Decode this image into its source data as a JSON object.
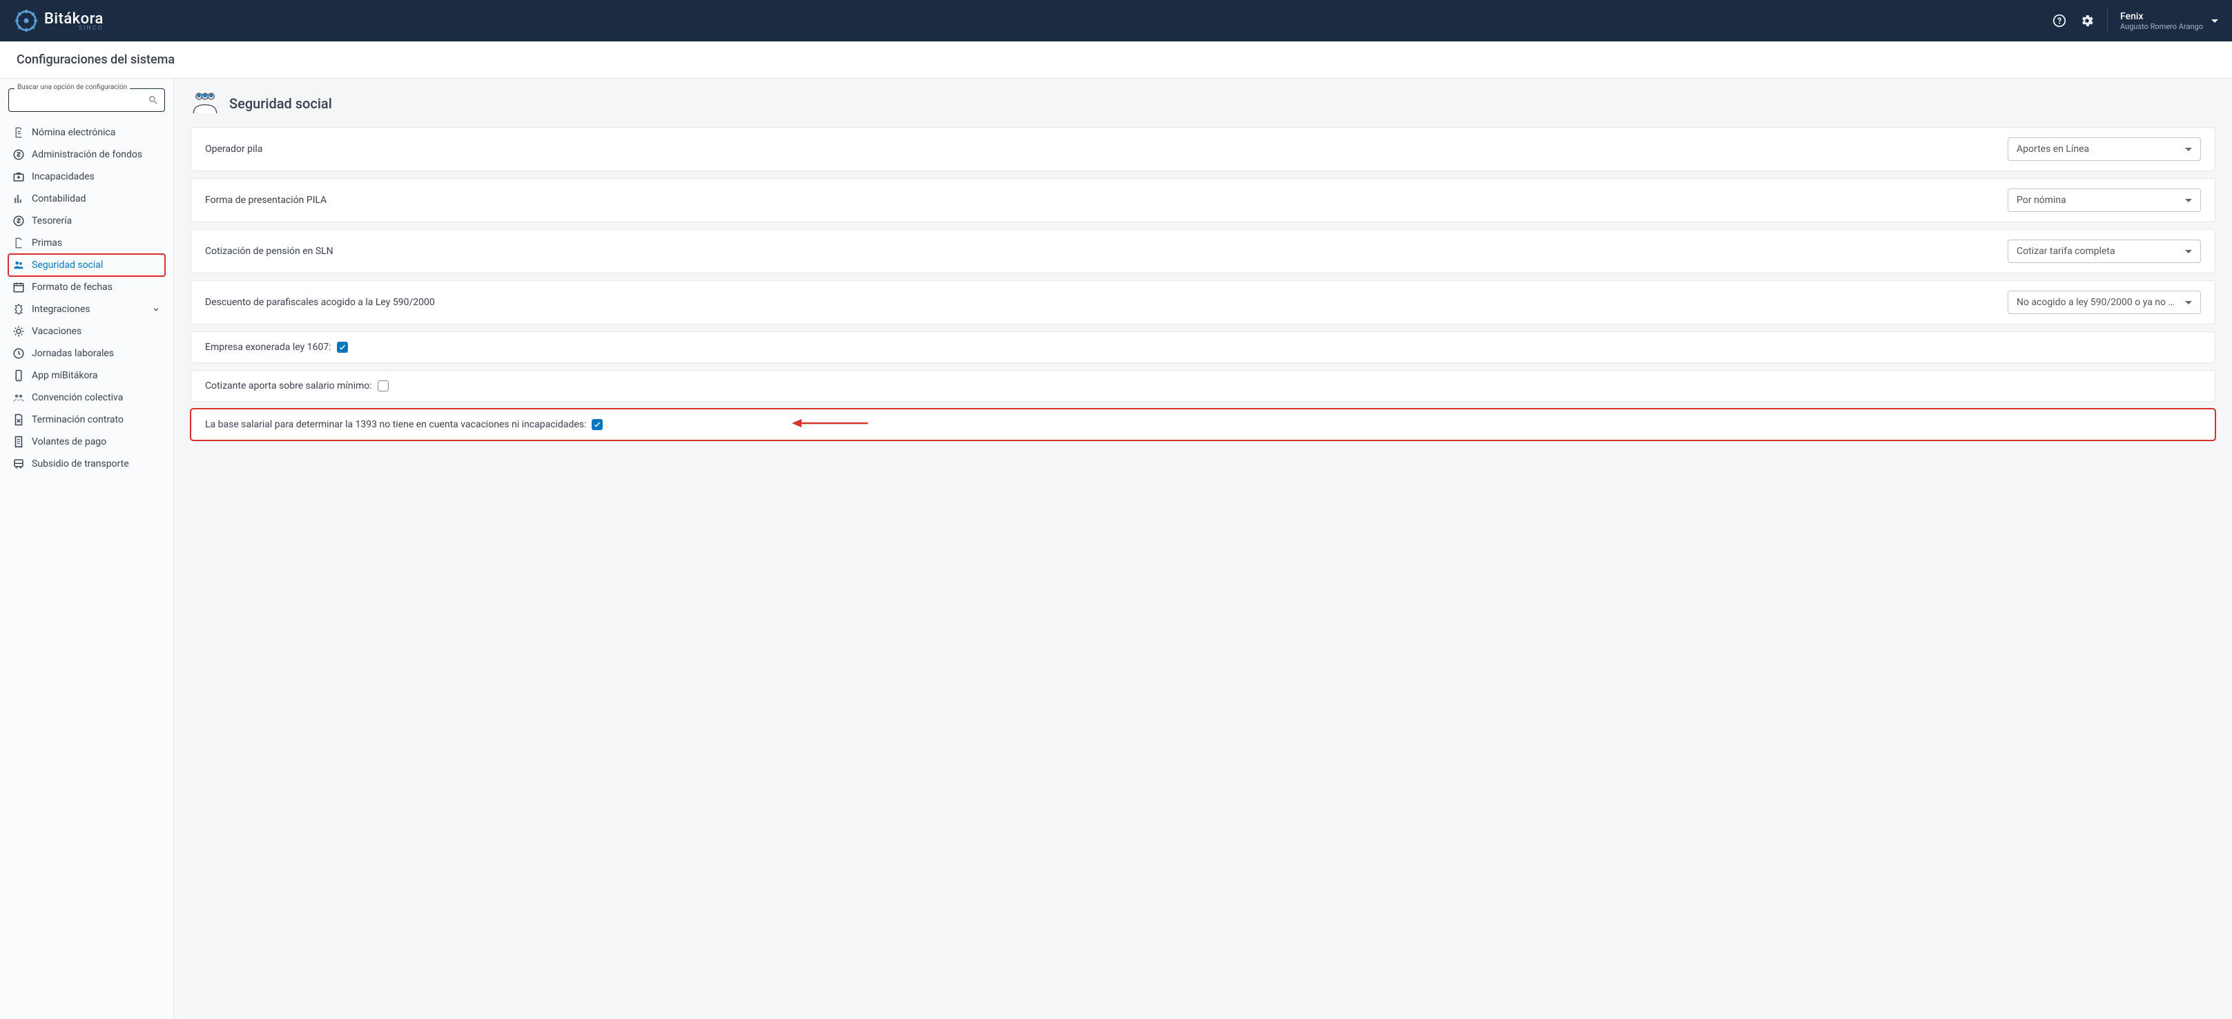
{
  "header": {
    "brand_name": "Bitákora",
    "brand_sub": "SINCO",
    "user_company": "Fenix",
    "user_fullname": "Augusto Romero Arango"
  },
  "page": {
    "title": "Configuraciones del sistema"
  },
  "sidebar": {
    "search_label": "Buscar una opción de configuración",
    "search_value": "",
    "items": [
      {
        "label": "Nómina electrónica",
        "icon": "document-icon"
      },
      {
        "label": "Administración de fondos",
        "icon": "money-icon"
      },
      {
        "label": "Incapacidades",
        "icon": "medkit-icon"
      },
      {
        "label": "Contabilidad",
        "icon": "chart-bars-icon"
      },
      {
        "label": "Tesorería",
        "icon": "money-icon"
      },
      {
        "label": "Primas",
        "icon": "file-icon"
      },
      {
        "label": "Seguridad social",
        "icon": "people-icon",
        "active": true,
        "highlighted": true
      },
      {
        "label": "Formato de fechas",
        "icon": "calendar-icon"
      },
      {
        "label": "Integraciones",
        "icon": "plugin-icon",
        "expandable": true
      },
      {
        "label": "Vacaciones",
        "icon": "sun-icon"
      },
      {
        "label": "Jornadas laborales",
        "icon": "clock-icon"
      },
      {
        "label": "App miBitákora",
        "icon": "phone-icon"
      },
      {
        "label": "Convención colectiva",
        "icon": "group-icon"
      },
      {
        "label": "Terminación contrato",
        "icon": "doc-x-icon"
      },
      {
        "label": "Volantes de pago",
        "icon": "receipt-icon"
      },
      {
        "label": "Subsidio de transporte",
        "icon": "bus-icon"
      }
    ]
  },
  "content": {
    "title": "Seguridad social",
    "rows": [
      {
        "label": "Operador pila",
        "type": "select",
        "value": "Aportes en Línea"
      },
      {
        "label": "Forma de presentación PILA",
        "type": "select",
        "value": "Por nómina"
      },
      {
        "label": "Cotización de pensión en SLN",
        "type": "select",
        "value": "Cotizar tarifa completa"
      },
      {
        "label": "Descuento de parafiscales acogido a la Ley 590/2000",
        "type": "select",
        "value": "No acogido a ley 590/2000 o ya no ap…"
      },
      {
        "label": "Empresa exonerada ley 1607:",
        "type": "checkbox",
        "checked": true
      },
      {
        "label": "Cotizante aporta sobre salario mínimo:",
        "type": "checkbox",
        "checked": false
      },
      {
        "label": "La base salarial para determinar la 1393 no tiene en cuenta vacaciones ni incapacidades:",
        "type": "checkbox",
        "checked": true,
        "callout": true
      }
    ]
  }
}
